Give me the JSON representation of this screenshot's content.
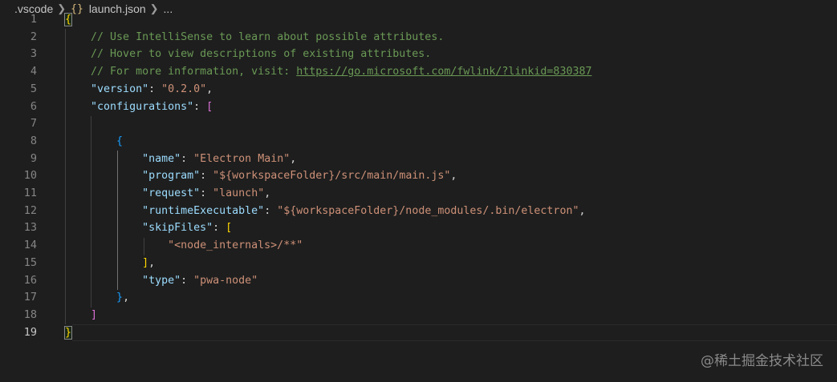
{
  "breadcrumb": {
    "folder": ".vscode",
    "file_icon": "{}",
    "file": "launch.json",
    "more": "..."
  },
  "editor": {
    "current_line": 19,
    "lines": [
      {
        "num": "1"
      },
      {
        "num": "2",
        "comment": "// Use IntelliSense to learn about possible attributes."
      },
      {
        "num": "3",
        "comment": "// Hover to view descriptions of existing attributes."
      },
      {
        "num": "4",
        "comment_prefix": "// For more information, visit: ",
        "link": "https://go.microsoft.com/fwlink/?linkid=830387"
      },
      {
        "num": "5",
        "key": "\"version\"",
        "value": "\"0.2.0\""
      },
      {
        "num": "6",
        "key": "\"configurations\"",
        "open": "["
      },
      {
        "num": "7"
      },
      {
        "num": "8",
        "open": "{"
      },
      {
        "num": "9",
        "key": "\"name\"",
        "value": "\"Electron Main\""
      },
      {
        "num": "10",
        "key": "\"program\"",
        "value": "\"${workspaceFolder}/src/main/main.js\""
      },
      {
        "num": "11",
        "key": "\"request\"",
        "value": "\"launch\""
      },
      {
        "num": "12",
        "key": "\"runtimeExecutable\"",
        "value": "\"${workspaceFolder}/node_modules/.bin/electron\""
      },
      {
        "num": "13",
        "key": "\"skipFiles\"",
        "open": "["
      },
      {
        "num": "14",
        "value": "\"<node_internals>/**\""
      },
      {
        "num": "15",
        "close": "]"
      },
      {
        "num": "16",
        "key": "\"type\"",
        "value": "\"pwa-node\""
      },
      {
        "num": "17",
        "close": "}"
      },
      {
        "num": "18",
        "close": "]"
      },
      {
        "num": "19",
        "close": "}"
      }
    ]
  },
  "colors": {
    "background": "#1e1e1e",
    "comment": "#6a9955",
    "key": "#9cdcfe",
    "string": "#ce9178",
    "bracket_level1": "#ffd700",
    "bracket_level2": "#da70d6",
    "bracket_level3": "#179fff"
  },
  "watermark": "@稀土掘金技术社区"
}
